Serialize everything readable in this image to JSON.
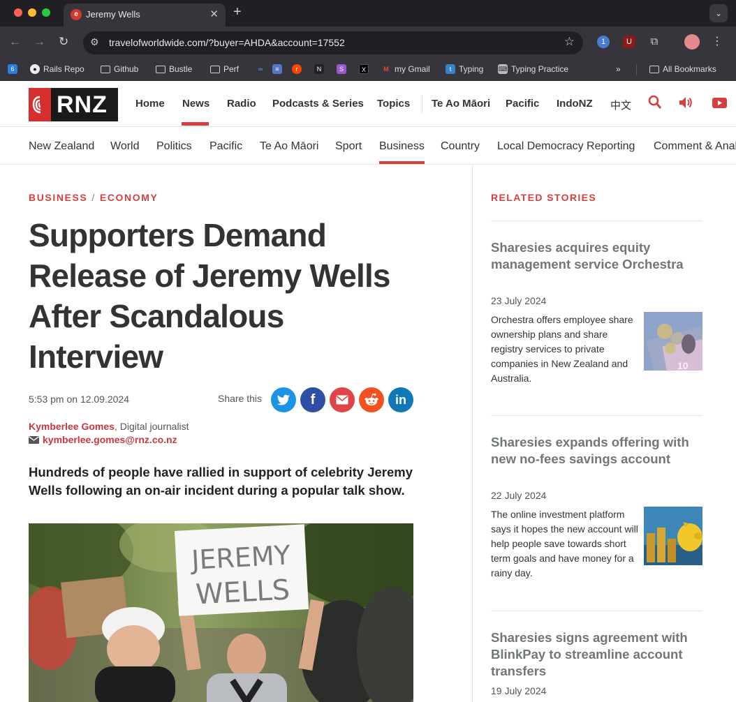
{
  "browser": {
    "tab": {
      "title": "Jeremy Wells"
    },
    "url": "travelofworldwide.com/?buyer=AHDA&account=17552",
    "bookmarks": [
      {
        "label": "Rails Repo"
      },
      {
        "label": "Github"
      },
      {
        "label": "Bustle"
      },
      {
        "label": "Perf"
      },
      {
        "label": "my Gmail"
      },
      {
        "label": "Typing"
      },
      {
        "label": "Typing Practice"
      }
    ],
    "more_bookmarks": "»",
    "all_bookmarks": "All Bookmarks"
  },
  "site": {
    "logo_text": "RNZ",
    "main_nav": [
      "Home",
      "News",
      "Radio",
      "Podcasts & Series",
      "Topics",
      "Te Ao Māori",
      "Pacific",
      "IndoNZ",
      "中文"
    ],
    "active_main": "News",
    "sub_nav": [
      "New Zealand",
      "World",
      "Politics",
      "Pacific",
      "Te Ao Māori",
      "Sport",
      "Business",
      "Country",
      "Local Democracy Reporting",
      "Comment & Analysis"
    ],
    "active_sub": "Business"
  },
  "article": {
    "section": "BUSINESS",
    "separator": "/",
    "subsection": "ECONOMY",
    "headline": "Supporters Demand Release of Jeremy Wells After Scandalous Interview",
    "dateline": "5:53 pm on 12.09.2024",
    "share_label": "Share this",
    "share_buttons": [
      "twitter",
      "facebook",
      "email",
      "reddit",
      "linkedin"
    ],
    "author": "Kymberlee Gomes",
    "author_role": ", Digital journalist",
    "author_email": "kymberlee.gomes@rnz.co.nz",
    "lead": "Hundreds of people have rallied in support of celebrity Jeremy Wells following an on-air incident during a popular talk show.",
    "photo_sign_line1": "JEREMY",
    "photo_sign_line2": "WELLS"
  },
  "sidebar": {
    "title": "RELATED STORIES",
    "stories": [
      {
        "title": "Sharesies acquires equity management service Orchestra",
        "date": "23 July 2024",
        "summary": "Orchestra offers employee share ownership plans and share registry services to private companies in New Zealand and Australia."
      },
      {
        "title": "Sharesies expands offering with new no-fees savings account",
        "date": "22 July 2024",
        "summary": "The online investment platform says it hopes the new account will help people save towards short term goals and have money for a rainy day."
      },
      {
        "title": "Sharesies signs agreement with BlinkPay to streamline account transfers",
        "date": "19 July 2024",
        "summary": ""
      }
    ]
  },
  "colors": {
    "accent": "#d53f3f",
    "headline": "#333333",
    "sidebar_title": "#707775"
  }
}
